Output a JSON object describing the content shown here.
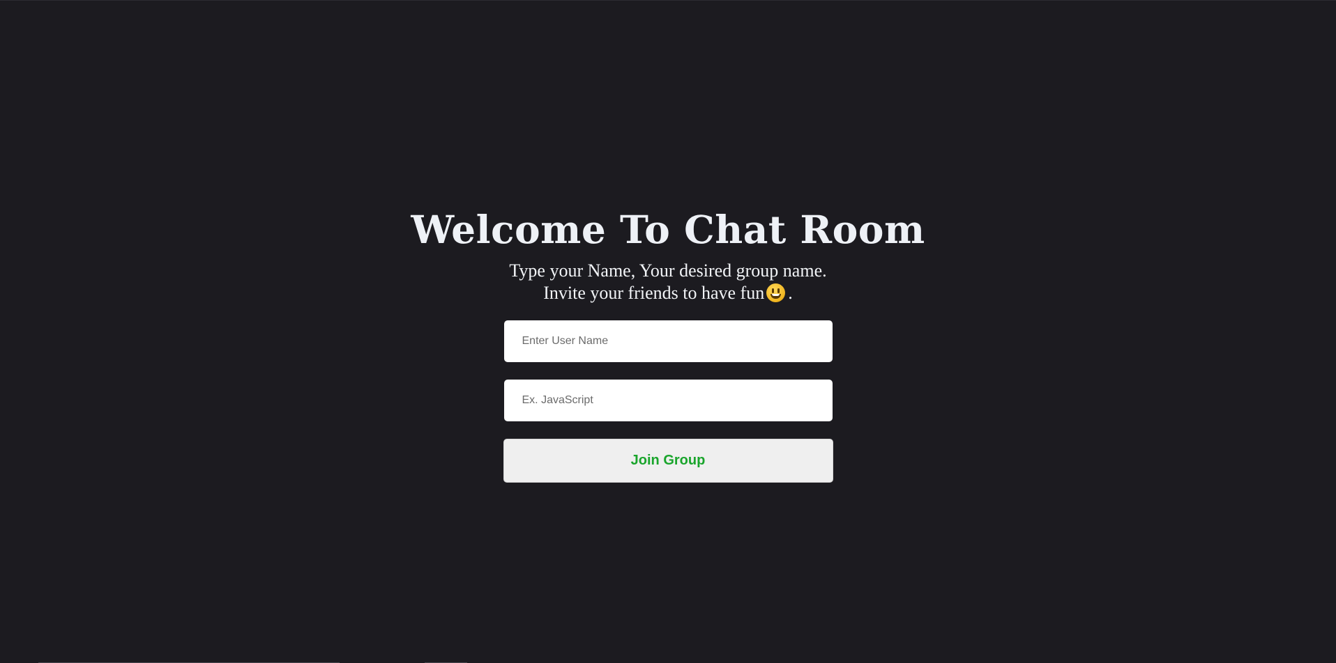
{
  "page": {
    "title": "Welcome To Chat Room",
    "subtitle_line1": "Type your Name, Your desired group name.",
    "subtitle_line2_before": "Invite your friends to have fun",
    "subtitle_line2_after": ".",
    "emoji_icon": "grinning-face-icon"
  },
  "form": {
    "username_placeholder": "Enter User Name",
    "username_value": "",
    "group_placeholder": "Ex. JavaScript",
    "group_value": "",
    "join_label": "Join Group"
  },
  "colors": {
    "background": "#1c1b20",
    "title_text": "#eef1f6",
    "join_label": "#1aa52c",
    "button_bg": "#efefef"
  }
}
